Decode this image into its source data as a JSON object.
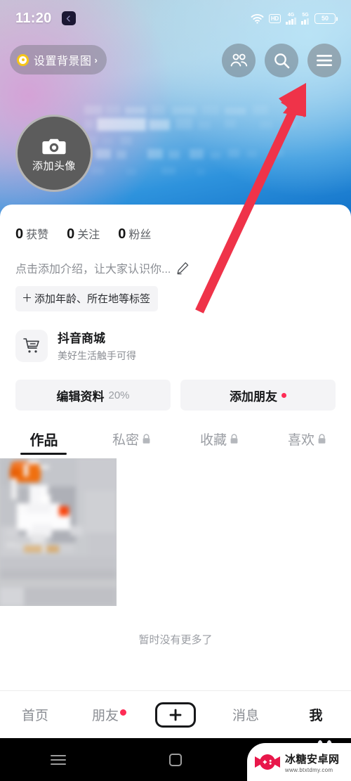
{
  "status_bar": {
    "time": "11:20",
    "app_icon": "back-chevron-app-icon",
    "wifi_icon": "wifi-icon",
    "hd_label": "HD",
    "net1_label": "4G",
    "net2_label": "5G",
    "battery_level": "50"
  },
  "hero": {
    "set_background": {
      "label": "设置背景图",
      "chevron": "›",
      "icon": "target-dot-icon"
    },
    "actions": [
      {
        "name": "friends-icon",
        "label": "朋友"
      },
      {
        "name": "search-icon",
        "label": "搜索"
      },
      {
        "name": "hamburger-menu-icon",
        "label": "菜单"
      }
    ],
    "avatar": {
      "icon": "camera-icon",
      "caption": "添加头像"
    }
  },
  "profile": {
    "stats": [
      {
        "num": "0",
        "label": "获赞"
      },
      {
        "num": "0",
        "label": "关注"
      },
      {
        "num": "0",
        "label": "粉丝"
      }
    ],
    "bio_placeholder": "点击添加介绍，让大家认识你...",
    "bio_edit_icon": "pencil-icon",
    "tag_button": {
      "plus": "＋",
      "label": "添加年龄、所在地等标签"
    }
  },
  "mall": {
    "icon": "shopping-cart-icon",
    "title": "抖音商城",
    "subtitle": "美好生活触手可得"
  },
  "action_buttons": [
    {
      "label": "编辑资料",
      "suffix": "20%",
      "badge": false
    },
    {
      "label": "添加朋友",
      "suffix": "",
      "badge": true
    }
  ],
  "tabs": [
    {
      "label": "作品",
      "locked": false,
      "active": true
    },
    {
      "label": "私密",
      "locked": true,
      "active": false
    },
    {
      "label": "收藏",
      "locked": true,
      "active": false
    },
    {
      "label": "喜欢",
      "locked": true,
      "active": false
    }
  ],
  "grid": {
    "empty_text": "暂时没有更多了"
  },
  "tabbar": [
    {
      "label": "首页",
      "type": "text",
      "active": false,
      "badge": false
    },
    {
      "label": "朋友",
      "type": "text",
      "active": false,
      "badge": true
    },
    {
      "label": "",
      "type": "plus",
      "active": false,
      "badge": false,
      "icon": "plus-icon"
    },
    {
      "label": "消息",
      "type": "text",
      "active": false,
      "badge": false
    },
    {
      "label": "我",
      "type": "text",
      "active": true,
      "badge": false
    }
  ],
  "android_nav": [
    {
      "name": "recents-icon"
    },
    {
      "name": "home-icon"
    },
    {
      "name": "back-icon"
    }
  ],
  "watermark": {
    "brand": "冰糖安卓网",
    "url": "www.btxtdmy.com"
  },
  "annotation": {
    "arrow_color": "#ef3349",
    "points_at": "hamburger-menu-icon"
  },
  "colors": {
    "accent_red": "#fe2c55",
    "arrow_red": "#ef3349",
    "text_primary": "#17181a",
    "text_secondary": "#8a8d93",
    "chip_bg": "#f4f4f6"
  }
}
